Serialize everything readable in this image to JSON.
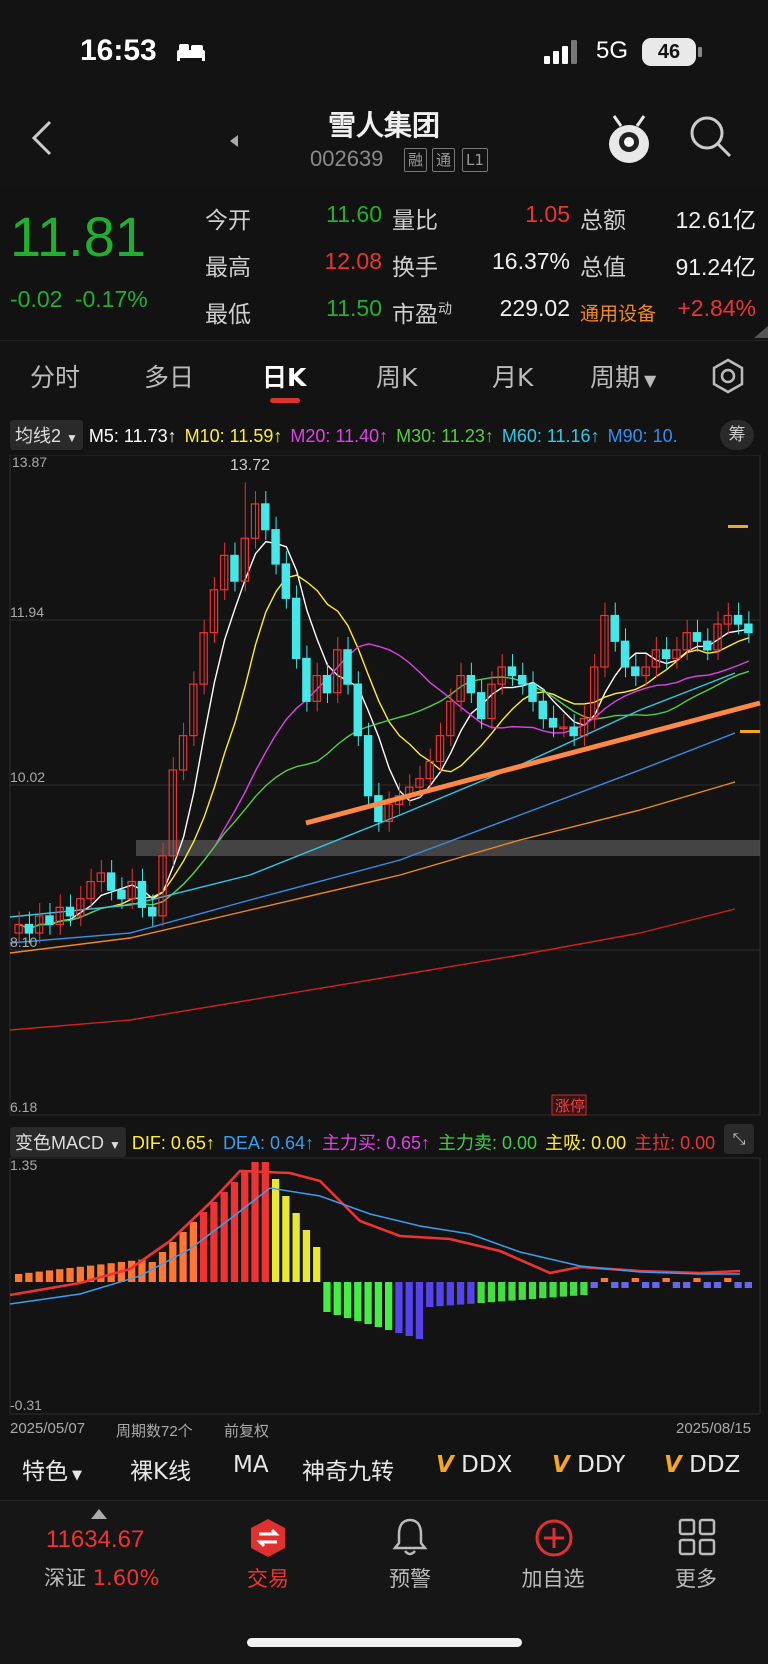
{
  "status": {
    "time": "16:53",
    "network": "5G",
    "battery": "46"
  },
  "header": {
    "name": "雪人集团",
    "code": "002639",
    "tags": [
      "融",
      "通",
      "L1"
    ]
  },
  "quote": {
    "price": "11.81",
    "change": "-0.02",
    "change_pct": "-0.17%",
    "rows": [
      [
        {
          "label": "今开",
          "value": "11.60",
          "color": "green"
        },
        {
          "label": "量比",
          "value": "1.05",
          "color": "red"
        },
        {
          "label": "总额",
          "value": "12.61亿",
          "color": "white"
        }
      ],
      [
        {
          "label": "最高",
          "value": "12.08",
          "color": "red"
        },
        {
          "label": "换手",
          "value": "16.37%",
          "color": "white"
        },
        {
          "label": "总值",
          "value": "91.24亿",
          "color": "white"
        }
      ],
      [
        {
          "label": "最低",
          "value": "11.50",
          "color": "green"
        },
        {
          "label": "市盈",
          "value": "229.02",
          "color": "white"
        },
        {
          "label": "通用设备",
          "value": "+2.84%",
          "color": "red"
        }
      ]
    ],
    "pe_sup": "动"
  },
  "tabs": [
    "分时",
    "多日",
    "日K",
    "周K",
    "月K",
    "周期"
  ],
  "active_tab": "日K",
  "ma_legend": {
    "chip": "均线2",
    "items": [
      {
        "text": "M5: 11.73↑",
        "color": "#ffffff"
      },
      {
        "text": "M10: 11.59↑",
        "color": "#ffee33"
      },
      {
        "text": "M20: 11.40↑",
        "color": "#e040e8"
      },
      {
        "text": "M30: 11.23↑",
        "color": "#55cc44"
      },
      {
        "text": "M60: 11.16↑",
        "color": "#33c8e8"
      },
      {
        "text": "M90: 10.",
        "color": "#3a8ee8"
      }
    ],
    "chip_right": "筹"
  },
  "kline_axis": {
    "labels": [
      "13.87",
      "11.94",
      "10.02",
      "8.10",
      "6.18"
    ],
    "high_label": "13.72",
    "badge": "涨停"
  },
  "macd_legend": {
    "chip": "变色MACD",
    "items": [
      {
        "text": "DIF: 0.65↑",
        "color": "#ffee33"
      },
      {
        "text": "DEA: 0.64↑",
        "color": "#3a9ef0"
      },
      {
        "text": "主力买: 0.65↑",
        "color": "#e040e8"
      },
      {
        "text": "主力卖: 0.00",
        "color": "#44cc44"
      },
      {
        "text": "主吸: 0.00",
        "color": "#ffee33"
      },
      {
        "text": "主拉: 0.00",
        "color": "#ee3333"
      }
    ]
  },
  "macd_axis": {
    "top": "1.35",
    "bottom": "-0.31"
  },
  "date_bar": {
    "start": "2025/05/07",
    "count": "周期数72个",
    "adjust": "前复权",
    "end": "2025/08/15"
  },
  "features": [
    "特色",
    "裸K线",
    "MA",
    "神奇九转",
    "DDX",
    "DDY",
    "DDZ"
  ],
  "nav": {
    "index_value": "11634.67",
    "index_name": "深证",
    "index_pct": "1.60%",
    "items": [
      "交易",
      "预警",
      "加自选",
      "更多"
    ]
  }
}
